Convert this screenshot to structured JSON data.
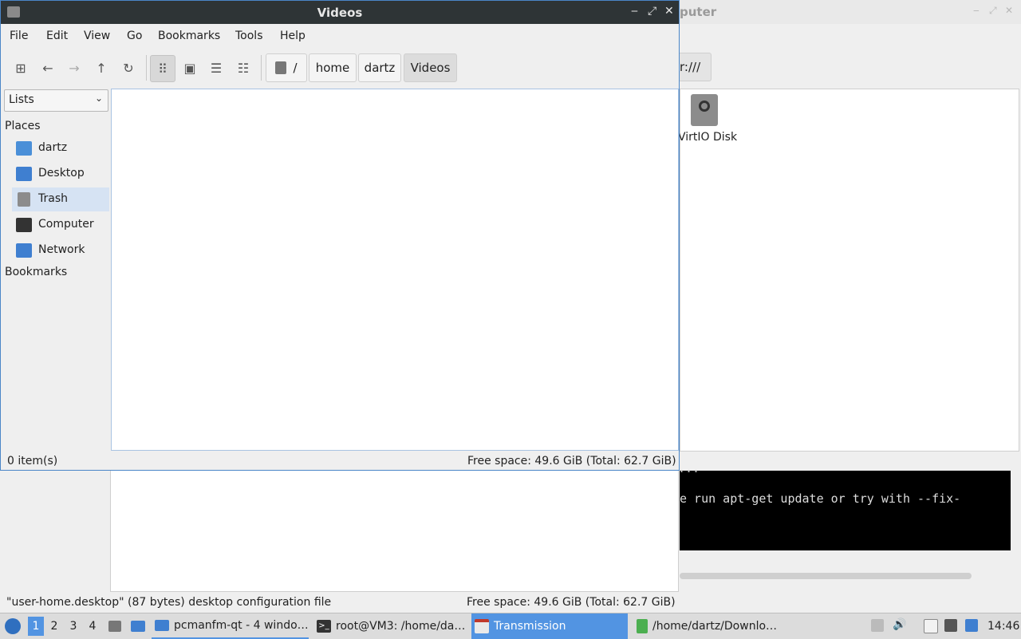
{
  "main_window": {
    "title": "Videos",
    "controls": {
      "minimize": "‒",
      "maximize": "⤢",
      "close": "✕"
    },
    "menu": [
      "File",
      "Edit",
      "View",
      "Go",
      "Bookmarks",
      "Tools",
      "Help"
    ],
    "toolbar": {
      "new_tab_icon": "new-tab-icon",
      "back_icon": "arrow-left-icon",
      "forward_icon": "arrow-right-icon",
      "up_icon": "arrow-up-icon",
      "reload_icon": "reload-icon"
    },
    "breadcrumb": [
      "/",
      "home",
      "dartz",
      "Videos"
    ],
    "sidebar": {
      "mode": "Lists",
      "places_header": "Places",
      "places": [
        {
          "label": "dartz",
          "icon": "home-folder-icon"
        },
        {
          "label": "Desktop",
          "icon": "desktop-icon"
        },
        {
          "label": "Trash",
          "icon": "trash-icon"
        },
        {
          "label": "Computer",
          "icon": "computer-icon"
        },
        {
          "label": "Network",
          "icon": "network-icon"
        }
      ],
      "bookmarks_header": "Bookmarks"
    },
    "status": {
      "items": "0 item(s)",
      "free_space": "Free space: 49.6 GiB (Total: 62.7 GiB)"
    }
  },
  "background_computer_window": {
    "title_fragment": "puter",
    "path_fragment": "r:///",
    "disk_label": "VirtIO Disk"
  },
  "background_file_window": {
    "status_left": "\"user-home.desktop\" (87 bytes) desktop configuration file",
    "status_right": "Free space: 49.6 GiB (Total: 62.7 GiB)"
  },
  "terminal": {
    "line1": "...",
    "line2": "e run apt-get update or try with --fix-"
  },
  "taskbar": {
    "workspaces": [
      "1",
      "2",
      "3",
      "4"
    ],
    "tasks": [
      {
        "label": "pcmanfm-qt - 4 windo…"
      },
      {
        "label": "root@VM3: /home/da…"
      },
      {
        "label": "Transmission"
      },
      {
        "label": "/home/dartz/Downlo…"
      }
    ],
    "clock": "14:46",
    "colors": {
      "accent": "#5294e2",
      "titlebar": "#2e3436"
    }
  }
}
